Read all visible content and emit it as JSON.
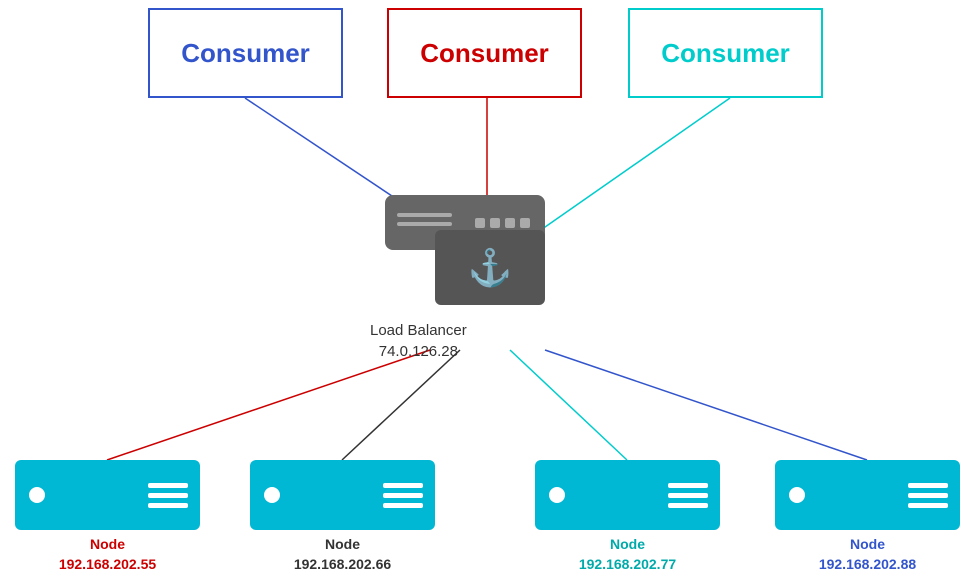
{
  "consumers": [
    {
      "id": "consumer-blue",
      "label": "Consumer",
      "color": "blue"
    },
    {
      "id": "consumer-red",
      "label": "Consumer",
      "color": "red"
    },
    {
      "id": "consumer-cyan",
      "label": "Consumer",
      "color": "cyan"
    }
  ],
  "load_balancer": {
    "label": "Load Balancer",
    "ip": "74.0.126.28"
  },
  "nodes": [
    {
      "id": "node1",
      "label": "Node",
      "ip": "192.168.202.55",
      "color": "red"
    },
    {
      "id": "node2",
      "label": "Node",
      "ip": "192.168.202.66",
      "color": "black"
    },
    {
      "id": "node3",
      "label": "Node",
      "ip": "192.168.202.77",
      "color": "cyan"
    },
    {
      "id": "node4",
      "label": "Node",
      "ip": "192.168.202.88",
      "color": "blue"
    }
  ]
}
